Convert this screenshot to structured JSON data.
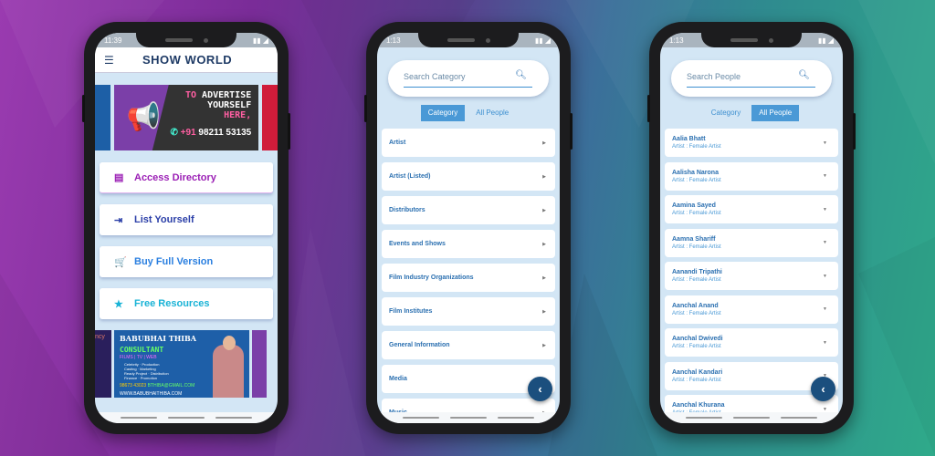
{
  "colors": {
    "primary_blue": "#2a6fb0",
    "tab_active": "#4a99d6",
    "fab": "#1b4f7e",
    "screen_bg": "#d3e6f5",
    "access_directory": "#9b1fb5",
    "list_yourself": "#2b3fa8",
    "buy_full_version": "#2a7fe0",
    "free_resources": "#19b3d6"
  },
  "phone1": {
    "status_time": "11:39",
    "app_title": "SHOW WORLD",
    "menu_icon": "hamburger-icon",
    "ad_banner": {
      "line1_a": "TO",
      "line1_b": "ADVERTISE",
      "line2": "YOURSELF",
      "line3": "HERE,",
      "phone_prefix": "+91",
      "phone_number": "98211 53135"
    },
    "buttons": [
      {
        "label": "Access Directory",
        "icon": "document-icon"
      },
      {
        "label": "List Yourself",
        "icon": "input-icon"
      },
      {
        "label": "Buy Full Version",
        "icon": "cart-icon"
      },
      {
        "label": "Free Resources",
        "icon": "star-icon"
      }
    ],
    "consultant_banner": {
      "name": "BABUBHAI THIBA",
      "title": "CONSULTANT",
      "media": "FILMS | TV | WEB",
      "services_left": [
        "Celebrity",
        "Casting",
        "Ready Project",
        "Finance"
      ],
      "services_right": [
        "Production",
        "Marketing",
        "Distribution",
        "Promotion"
      ],
      "phone": "98673 43023",
      "email": "BTHIBA@GMAIL.COM",
      "website": "WWW.BABUBHAITHIBA.COM"
    }
  },
  "phone2": {
    "status_time": "1:13",
    "search_placeholder": "Search Category",
    "tabs": [
      {
        "label": "Category",
        "active": true
      },
      {
        "label": "All People",
        "active": false
      }
    ],
    "categories": [
      "Artist",
      "Artist (Listed)",
      "Distributors",
      "Events and Shows",
      "Film Industry Organizations",
      "Film Institutes",
      "General Information",
      "Media",
      "Music"
    ],
    "fab_icon": "chevron-left-icon"
  },
  "phone3": {
    "status_time": "1:13",
    "search_placeholder": "Search People",
    "tabs": [
      {
        "label": "Category",
        "active": false
      },
      {
        "label": "All People",
        "active": true
      }
    ],
    "people": [
      {
        "name": "Aalia Bhatt",
        "role": "Artist : Female Artist"
      },
      {
        "name": "Aalisha Narona",
        "role": "Artist : Female Artist"
      },
      {
        "name": "Aamina Sayed",
        "role": "Artist : Female Artist"
      },
      {
        "name": "Aamna Shariff",
        "role": "Artist : Female Artist"
      },
      {
        "name": "Aanandi Tripathi",
        "role": "Artist : Female Artist"
      },
      {
        "name": "Aanchal Anand",
        "role": "Artist : Female Artist"
      },
      {
        "name": "Aanchal Dwivedi",
        "role": "Artist : Female Artist"
      },
      {
        "name": "Aanchal Kandari",
        "role": "Artist : Female Artist"
      },
      {
        "name": "Aanchal Khurana",
        "role": "Artist : Female Artist"
      }
    ],
    "fab_icon": "chevron-left-icon"
  }
}
